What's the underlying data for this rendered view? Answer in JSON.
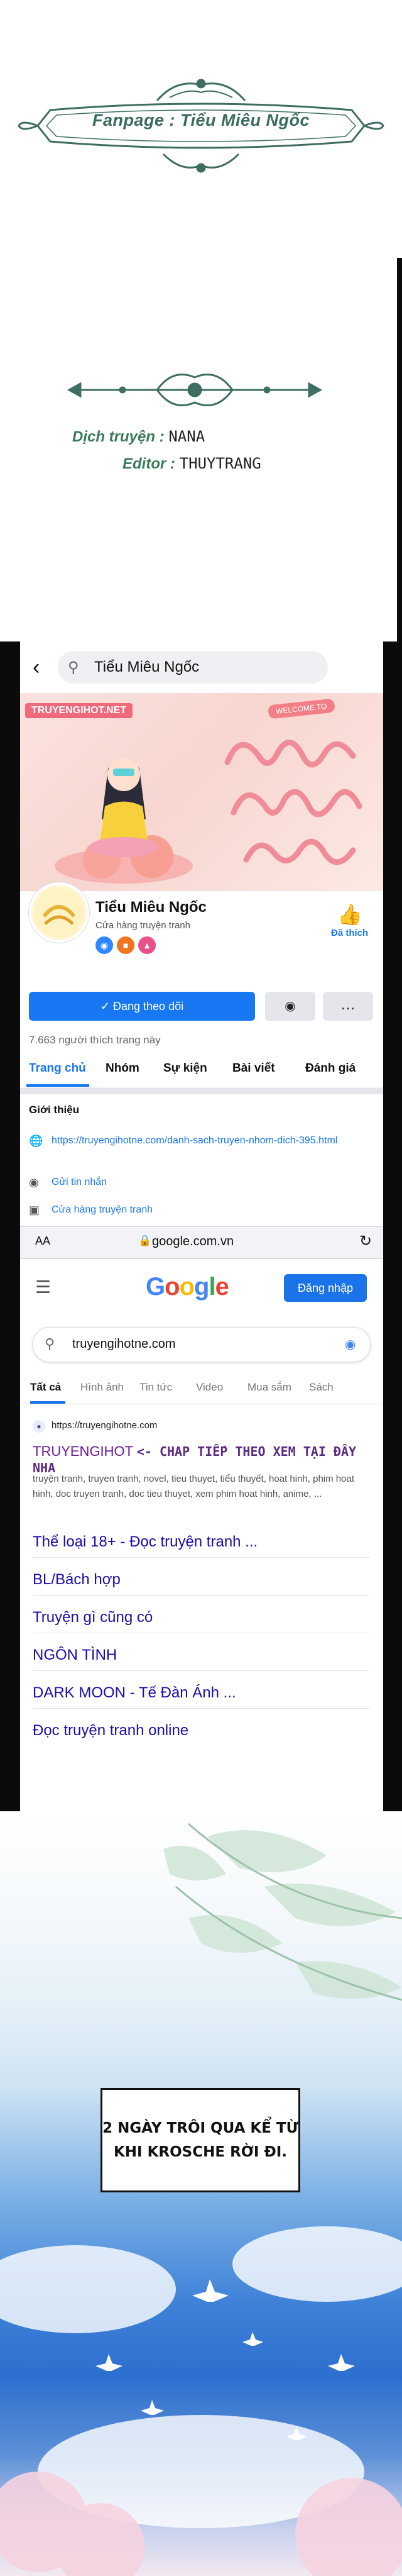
{
  "credits": {
    "fanpage": "Fanpage : Tiểu Miêu Ngốc",
    "translator_label": "Dịch truyện :",
    "translator": "NANA",
    "editor_label": "Editor :",
    "editor": "THUYTRANG"
  },
  "facebook": {
    "search_query": "Tiểu Miêu Ngốc",
    "cover_tag": "TRUYENGIHOT.NET",
    "cover_welcome": "WELCOME TO",
    "page_name": "Tiểu Miêu Ngốc",
    "page_category": "Cửa hàng truyện tranh",
    "like_label": "Đã thích",
    "follow_button": "Đang theo dõi",
    "likes_count": "7.663 người thích trang này",
    "tabs": [
      "Trang chủ",
      "Nhóm",
      "Sự kiện",
      "Bài viết",
      "Đánh giá"
    ],
    "intro": {
      "title": "Giới thiệu",
      "url": "https://truyengihotne.com/danh-sach-truyen-nhom-dich-395.html",
      "message": "Gửi tin nhắn",
      "shop": "Cửa hàng truyện tranh"
    }
  },
  "safari": {
    "aa": "AA",
    "domain": "google.com.vn"
  },
  "google": {
    "logo": "Google",
    "signin": "Đăng nhập",
    "query": "truyengihotne.com",
    "tabs": [
      "Tất cả",
      "Hình ảnh",
      "Tin tức",
      "Video",
      "Mua sắm",
      "Sách"
    ],
    "result": {
      "url": "https://truyengihotne.com",
      "title": "TRUYENGIHOT",
      "title_note": "<- CHAP TIẾP THEO XEM TẠI ĐÂY NHA",
      "snippet": "truyện tranh, truyen tranh, novel, tieu thuyet, tiểu thuyết, hoat hinh, phim hoat hinh, doc truyen tranh, doc tieu thuyet, xem phim hoat hinh, anime, ...",
      "sitelinks": [
        "Thể loại 18+ - Đọc truyện tranh ...",
        "BL/Bách hợp",
        "Truyện gì cũng có",
        "NGÔN TÌNH",
        "DARK MOON - Tế Đàn Ánh ...",
        "Đọc truyện tranh online"
      ]
    }
  },
  "narration": {
    "line1": "2 NGÀY TRÔI QUA KỂ TỪ",
    "line2": "KHI KROSCHE RỜI ĐI."
  },
  "colors": {
    "facebook_blue": "#1877f2",
    "google_blue": "#1a73e8",
    "credit_green": "#3b7a5a",
    "visited_link": "#6a1b9a"
  }
}
